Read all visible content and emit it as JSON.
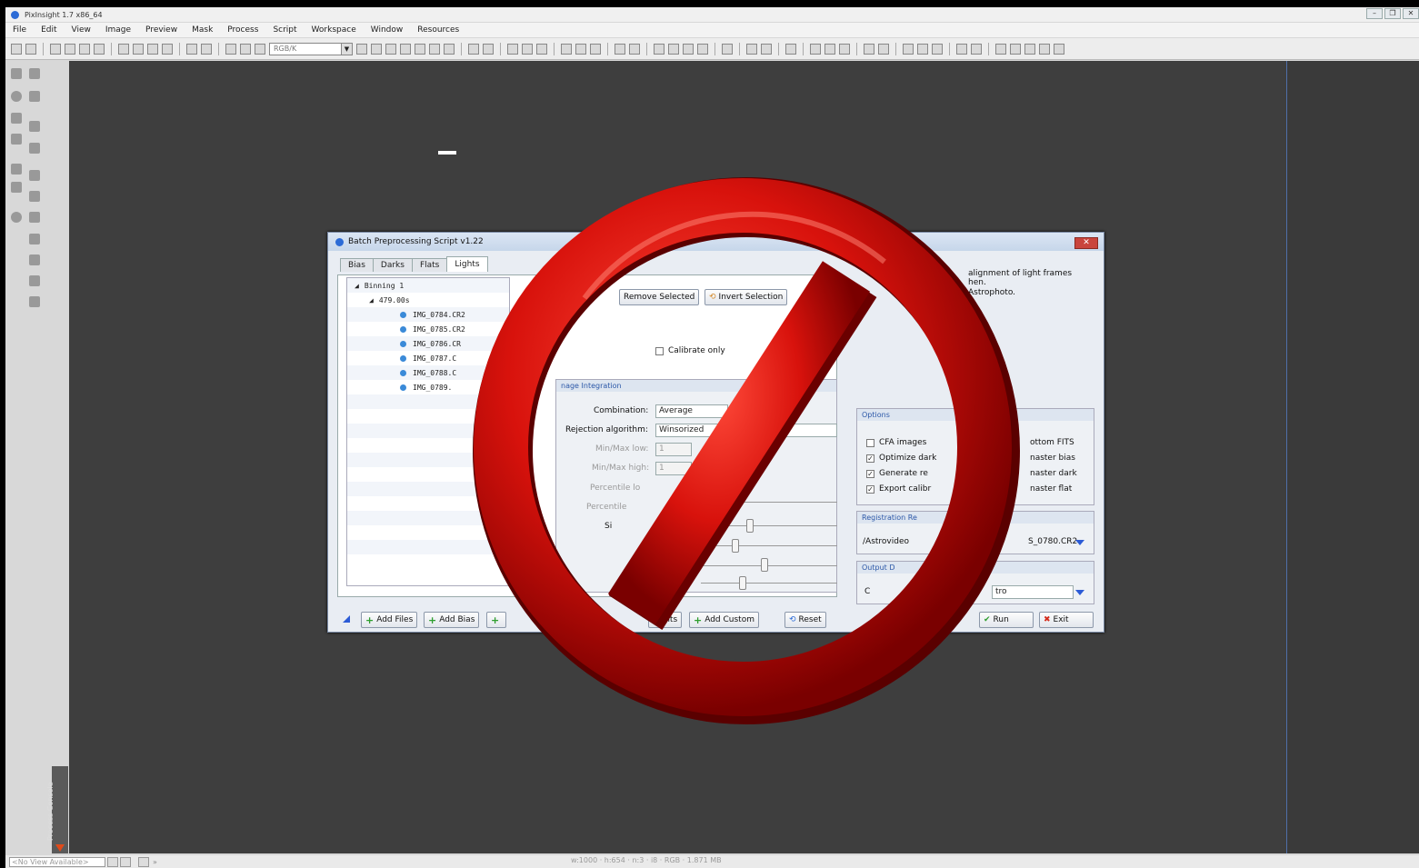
{
  "app": {
    "title": "PixInsight 1.7 x86_64",
    "window_controls": [
      "–",
      "❐",
      "✕"
    ]
  },
  "menu": [
    "File",
    "Edit",
    "View",
    "Image",
    "Preview",
    "Mask",
    "Process",
    "Script",
    "Workspace",
    "Window",
    "Resources"
  ],
  "toolbar": {
    "color_space": "RGB/K"
  },
  "console": {
    "label": "Process Console"
  },
  "status": {
    "view_combo": "<No View Available>",
    "more": "»",
    "info": "w:1000 · h:654 · n:3 · i8 · RGB · 1.871 MB"
  },
  "dialog": {
    "title": "Batch Preprocessing Script v1.22",
    "close": "✕",
    "tabs": [
      "Bias",
      "Darks",
      "Flats",
      "Lights"
    ],
    "tree": {
      "root": "Binning 1",
      "exposure": "479.00s",
      "files": [
        "IMG_0784.CR2",
        "IMG_0785.CR2",
        "IMG_0786.CR",
        "IMG_0787.C",
        "IMG_0788.C",
        "IMG_0789."
      ]
    },
    "buttons": {
      "remove_selected": "Remove Selected",
      "invert_selection": "Invert Selection",
      "add_files": "Add Files",
      "add_bias": "Add Bias",
      "add_lights": "Lights",
      "add_custom": "Add Custom",
      "reset": "Reset",
      "run": "Run",
      "exit": "Exit"
    },
    "calibrate_only": "Calibrate only",
    "integration": {
      "header": "nage Integration",
      "combination_label": "Combination:",
      "combination_value": "Average",
      "rejection_label": "Rejection algorithm:",
      "rejection_value": "Winsorized",
      "minmax_low_label": "Min/Max low:",
      "minmax_low_value": "1",
      "minmax_high_label": "Min/Max high:",
      "minmax_high_value": "1",
      "percentile_low_label": "Percentile lo",
      "percentile_high_label": "Percentile",
      "sigma_label": "Si"
    },
    "info_text": [
      "alignment of light frames",
      "hen.",
      "Astrophoto."
    ],
    "options": {
      "header": "Options",
      "items": [
        {
          "label": "CFA images",
          "checked": false
        },
        {
          "label": "Optimize dark",
          "checked": true
        },
        {
          "label": "Generate re",
          "checked": true
        },
        {
          "label": "Export calibr",
          "checked": true
        }
      ],
      "right_items": [
        "ottom FITS",
        "naster bias",
        "naster dark",
        "naster flat"
      ]
    },
    "registration": {
      "header": "Registration Re",
      "path": "/Astrovideo",
      "file": "S_0780.CR2"
    },
    "output": {
      "header": "Output D",
      "path": "C",
      "suffix": "tro"
    }
  }
}
